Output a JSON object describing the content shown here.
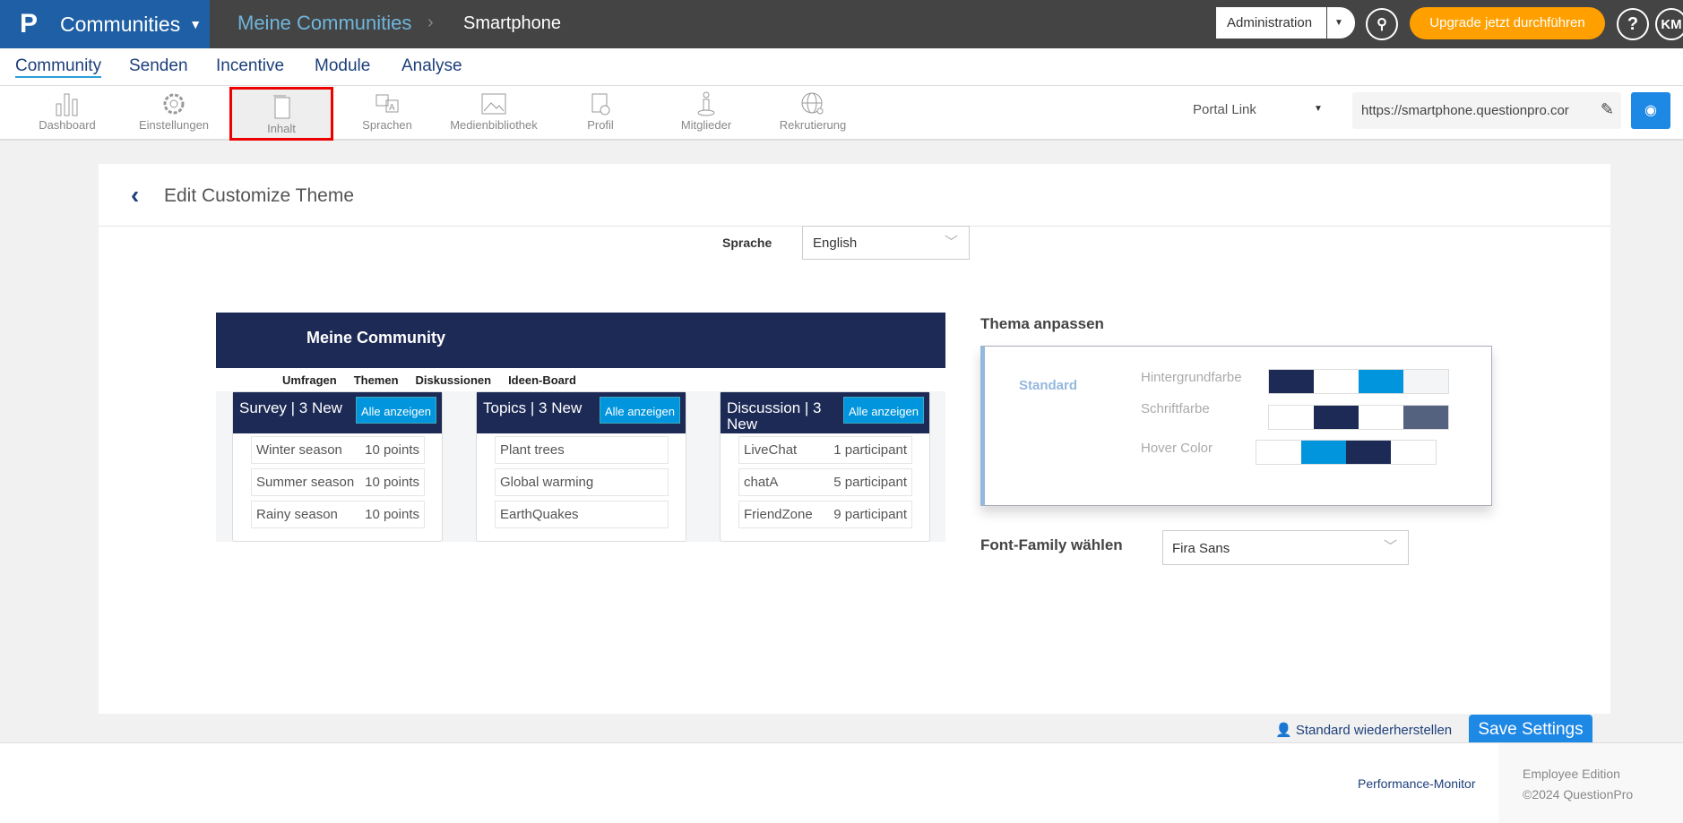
{
  "topbar": {
    "app": "Communities",
    "breadcrumb_parent": "Meine Communities",
    "breadcrumb_current": "Smartphone",
    "admin": "Administration",
    "upgrade": "Upgrade jetzt durchführen",
    "help": "?",
    "avatar": "KM"
  },
  "nav": [
    "Community",
    "Senden",
    "Incentive",
    "Module",
    "Analyse"
  ],
  "toolbar": {
    "items": [
      "Dashboard",
      "Einstellungen",
      "Inhalt",
      "Sprachen",
      "Medienbibliothek",
      "Profil",
      "Mitglieder",
      "Rekrutierung"
    ],
    "portal_label": "Portal Link",
    "url": "https://smartphone.questionpro.cor"
  },
  "page": {
    "title": "Edit Customize Theme",
    "lang_label": "Sprache",
    "lang_value": "English"
  },
  "preview": {
    "title": "Meine Community",
    "nav": [
      "Umfragen",
      "Themen",
      "Diskussionen",
      "Ideen-Board"
    ],
    "view_all": "Alle anzeigen",
    "cards": [
      {
        "title": "Survey | 3 New",
        "rows": [
          [
            "Winter season",
            "10 points"
          ],
          [
            "Summer season",
            "10 points"
          ],
          [
            "Rainy season",
            "10 points"
          ]
        ]
      },
      {
        "title": "Topics | 3 New",
        "rows": [
          [
            "Plant trees",
            ""
          ],
          [
            "Global warming",
            ""
          ],
          [
            "EarthQuakes",
            ""
          ]
        ]
      },
      {
        "title": "Discussion | 3 New",
        "rows": [
          [
            "LiveChat",
            "1 participant"
          ],
          [
            "chatA",
            "5 participant"
          ],
          [
            "FriendZone",
            "9 participant"
          ]
        ]
      }
    ]
  },
  "theme": {
    "heading": "Thema anpassen",
    "preset": "Standard",
    "bg_label": "Hintergrundfarbe",
    "font_label": "Schriftfarbe",
    "hover_label": "Hover Color",
    "bg_colors": [
      "#1c2a55",
      "#ffffff",
      "#0095dc",
      "#f4f5f7"
    ],
    "font_colors": [
      "#ffffff",
      "#1c2a55",
      "#ffffff",
      "#54617f"
    ],
    "hover_colors": [
      "#ffffff",
      "#0095dc",
      "#1c2a55",
      "#ffffff"
    ],
    "font_family_label": "Font-Family wählen",
    "font_family_value": "Fira Sans"
  },
  "actions": {
    "reset": "Standard wiederherstellen",
    "save": "Save Settings"
  },
  "footer": {
    "link": "Performance-Monitor",
    "edition": "Employee Edition",
    "copyright": "©2024 QuestionPro"
  },
  "colors": {
    "brand": "#1f5fa5",
    "accent": "#1e88e5",
    "upgrade": "#ffa000",
    "navy": "#1c2a55"
  }
}
